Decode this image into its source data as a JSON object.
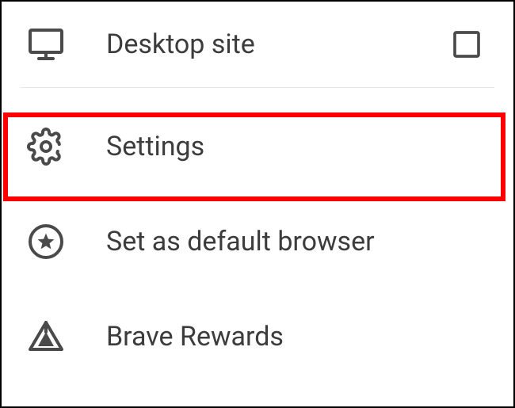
{
  "menu": {
    "items": [
      {
        "id": "desktop-site",
        "label": "Desktop site"
      },
      {
        "id": "settings",
        "label": "Settings"
      },
      {
        "id": "default-browser",
        "label": "Set as default browser"
      },
      {
        "id": "brave-rewards",
        "label": "Brave Rewards"
      }
    ]
  },
  "highlight": {
    "target": "settings",
    "color": "#ff0000"
  }
}
